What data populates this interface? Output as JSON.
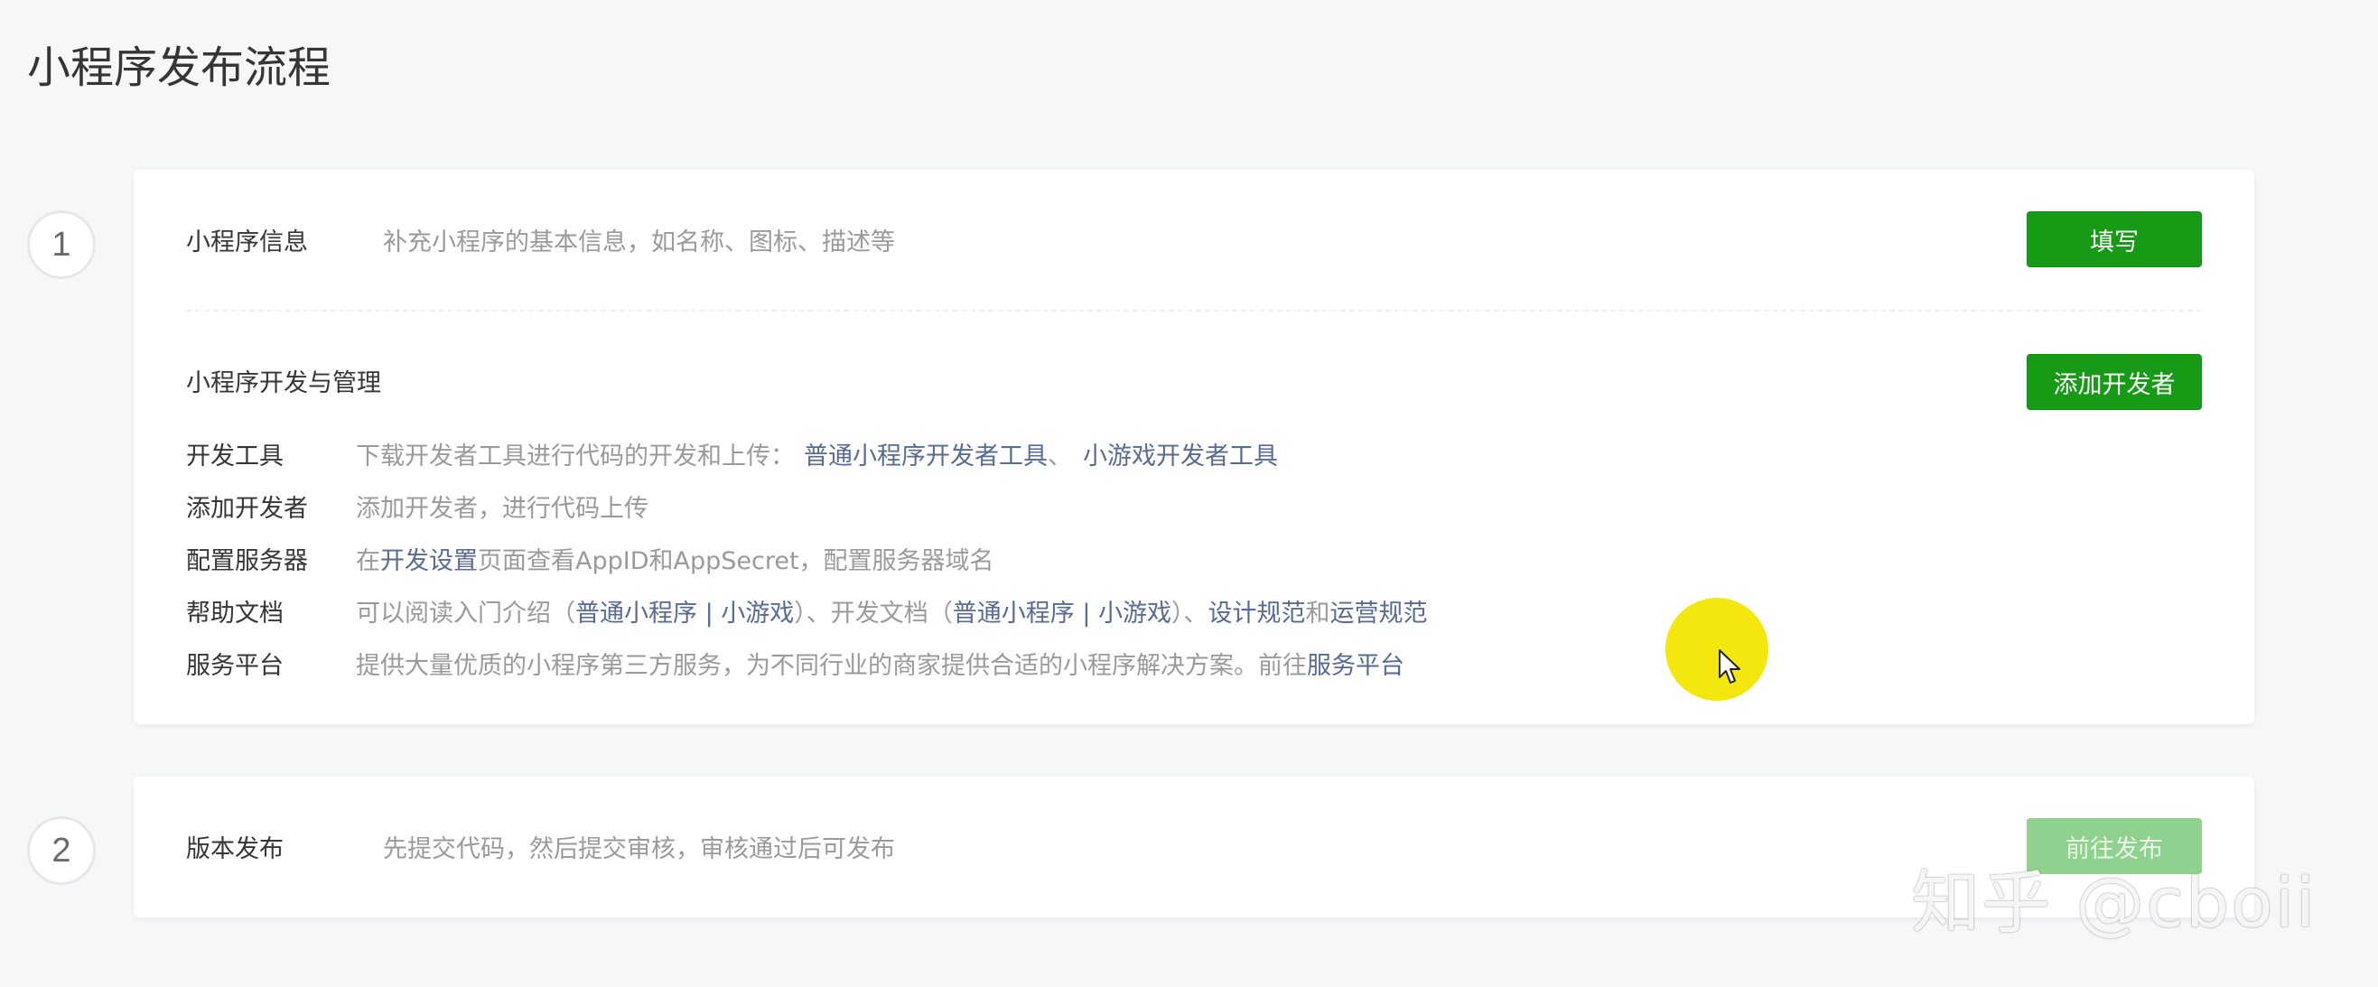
{
  "page": {
    "title": "小程序发布流程"
  },
  "steps": [
    {
      "number": "1"
    },
    {
      "number": "2"
    }
  ],
  "step1": {
    "info": {
      "title": "小程序信息",
      "desc": "补充小程序的基本信息，如名称、图标、描述等",
      "button": "填写"
    },
    "dev": {
      "title": "小程序开发与管理",
      "button": "添加开发者",
      "items": [
        {
          "label": "开发工具",
          "text1": "下载开发者工具进行代码的开发和上传：",
          "link1": "普通小程序开发者工具",
          "sep1": "、",
          "link2": "小游戏开发者工具"
        },
        {
          "label": "添加开发者",
          "text1": "添加开发者，进行代码上传"
        },
        {
          "label": "配置服务器",
          "text1": "在 ",
          "link1": "开发设置",
          "text2": "页面查看AppID和AppSecret，配置服务器域名"
        },
        {
          "label": "帮助文档",
          "text1": "可以阅读入门介绍（ ",
          "link1": "普通小程序 | 小游戏",
          "text2": "）、开发文档（ ",
          "link2": "普通小程序 | 小游戏",
          "text3": "）、 ",
          "link3": "设计规范",
          "text4": "和 ",
          "link4": "运营规范"
        },
        {
          "label": "服务平台",
          "text1": "提供大量优质的小程序第三方服务，为不同行业的商家提供合适的小程序解决方案。前往 ",
          "link1": "服务平台"
        }
      ]
    }
  },
  "step2": {
    "title": "版本发布",
    "desc": "先提交代码，然后提交审核，审核通过后可发布",
    "button": "前往发布"
  },
  "watermark": "知乎 @cboii",
  "colors": {
    "accent_green": "#179b16",
    "link_blue": "#576b95",
    "cursor_highlight": "#f3e600"
  }
}
